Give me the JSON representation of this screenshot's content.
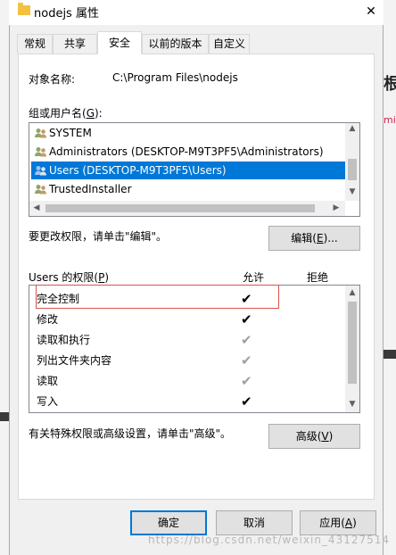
{
  "window": {
    "title": "nodejs 属性",
    "close": "✕"
  },
  "tabs": [
    "常规",
    "共享",
    "安全",
    "以前的版本",
    "自定义"
  ],
  "active_tab": "安全",
  "object": {
    "label": "对象名称:",
    "value": "C:\\Program Files\\nodejs"
  },
  "groups": {
    "label_prefix": "组或用户名(",
    "label_key": "G",
    "label_suffix": "):",
    "items": [
      "SYSTEM",
      "Administrators (DESKTOP-M9T3PF5\\Administrators)",
      "Users (DESKTOP-M9T3PF5\\Users)",
      "TrustedInstaller"
    ],
    "selected": "Users (DESKTOP-M9T3PF5\\Users)"
  },
  "change_hint": "要更改权限，请单击\"编辑\"。",
  "edit_button": {
    "prefix": "编辑(",
    "key": "E",
    "suffix": ")..."
  },
  "permissions": {
    "label_prefix": "Users 的权限(",
    "label_key": "P",
    "label_suffix": ")",
    "allow_header": "允许",
    "deny_header": "拒绝",
    "rows": [
      {
        "name": "完全控制",
        "allow": "✔",
        "allow_state": "explicit"
      },
      {
        "name": "修改",
        "allow": "✔",
        "allow_state": "explicit"
      },
      {
        "name": "读取和执行",
        "allow": "✔",
        "allow_state": "inherited"
      },
      {
        "name": "列出文件夹内容",
        "allow": "✔",
        "allow_state": "inherited"
      },
      {
        "name": "读取",
        "allow": "✔",
        "allow_state": "inherited"
      },
      {
        "name": "写入",
        "allow": "✔",
        "allow_state": "explicit"
      }
    ]
  },
  "special_hint": "有关特殊权限或高级设置，请单击\"高级\"。",
  "advanced_button": {
    "prefix": "高级(",
    "key": "V",
    "suffix": ")"
  },
  "footer": {
    "ok": "确定",
    "cancel": "取消",
    "apply_prefix": "应用(",
    "apply_key": "A",
    "apply_suffix": ")"
  },
  "watermark": "https://blog.csdn.net/weixin_43127514",
  "colors": {
    "selection": "#0078d7",
    "highlight_box": "#d9534f",
    "folder_icon": "#f3c140"
  }
}
